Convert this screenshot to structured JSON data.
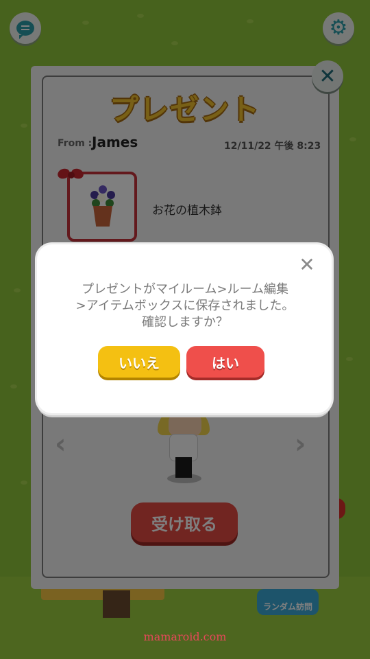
{
  "present_panel": {
    "title": "プレゼント",
    "from_label": "From :",
    "from_name": "James",
    "date": "12/11/22 午後 8:23",
    "item_name": "お花の植木鉢",
    "receive_button": "受け取る",
    "close_icon": "close-icon"
  },
  "background": {
    "random_visit_label": "ランダム訪問"
  },
  "dialog": {
    "message_lines": [
      "プレゼントがマイルーム>ルーム編集",
      ">アイテムボックスに保存されました。",
      "確認しますか？"
    ],
    "no_button": "いいえ",
    "yes_button": "はい"
  },
  "watermark": "mamaroid.com",
  "colors": {
    "accent_teal": "#2a9da8",
    "title_gold": "#f1c12e",
    "button_yellow": "#f4c012",
    "button_red": "#ef4f4b",
    "grass": "#8fc43a"
  }
}
